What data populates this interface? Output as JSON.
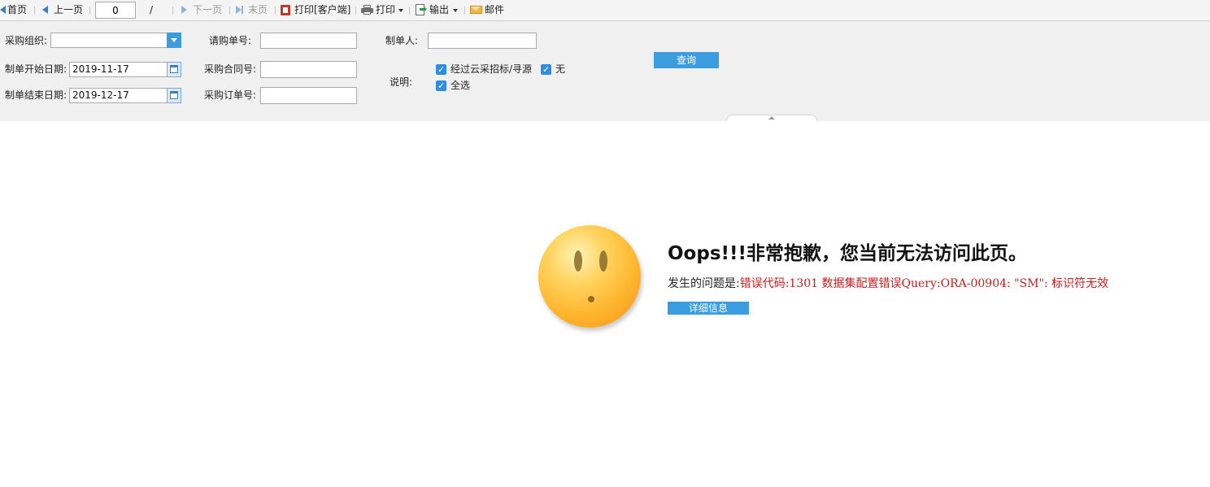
{
  "toolbar": {
    "first": "首页",
    "prev": "上一页",
    "page_value": "0",
    "page_sep": "/",
    "next": "下一页",
    "last": "末页",
    "print_client": "打印[客户端]",
    "print": "打印",
    "export": "输出",
    "mail": "邮件"
  },
  "form": {
    "purchase_org_label": "采购组织:",
    "purchase_org_value": "",
    "request_no_label": "请购单号:",
    "request_no_value": "",
    "creator_label": "制单人:",
    "creator_value": "",
    "start_date_label": "制单开始日期:",
    "start_date_value": "2019-11-17",
    "contract_no_label": "采购合同号:",
    "contract_no_value": "",
    "end_date_label": "制单结束日期:",
    "end_date_value": "2019-12-17",
    "order_no_label": "采购订单号:",
    "order_no_value": "",
    "note_label": "说明:",
    "opt_cloud": "经过云采招标/寻源",
    "opt_none": "无",
    "opt_all": "全选",
    "query_button": "查询"
  },
  "error": {
    "title": "Oops!!!非常抱歉，您当前无法访问此页。",
    "problem_prefix": "发生的问题是:",
    "message": "错误代码:1301 数据集配置错误Query:ORA-00904: \"SM\": 标识符无效",
    "detail_button": "详细信息"
  },
  "colors": {
    "accent": "#3b9ce0",
    "error_text": "#cc1d1d",
    "panel_bg": "#f0f0f0"
  }
}
